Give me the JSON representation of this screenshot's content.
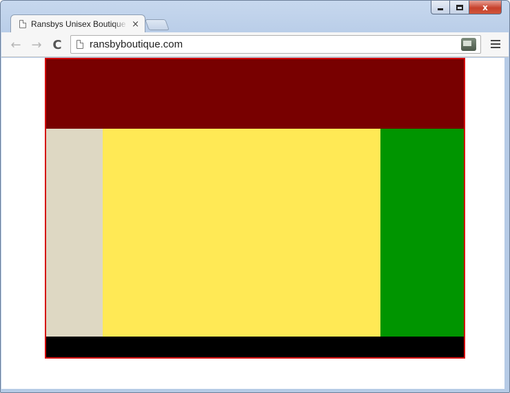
{
  "browser": {
    "tab": {
      "title": "Ransbys Unisex Boutique (",
      "close_glyph": "×",
      "icon": "page-icon"
    },
    "controls": {
      "close_glyph": "x",
      "minimize_icon": "minimize-icon",
      "maximize_icon": "maximize-icon"
    },
    "toolbar": {
      "back_glyph": "←",
      "forward_glyph": "→",
      "reload_glyph": "C",
      "url": "ransbyboutique.com"
    }
  },
  "page": {
    "colors": {
      "border": "#d40000",
      "header": "#780000",
      "left_column": "#ded8c3",
      "main_column": "#ffe955",
      "right_column": "#009500",
      "footer": "#000000"
    }
  }
}
